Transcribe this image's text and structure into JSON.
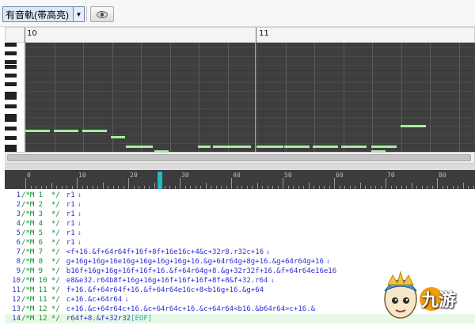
{
  "toolbar": {
    "track_select_value": "有音軌(帯高亮)",
    "dropdown_icon": "chevron-down-icon",
    "visibility_icon": "eye-icon"
  },
  "piano_roll": {
    "measures": [
      "10",
      "11"
    ]
  },
  "editor_ruler": {
    "ticks": [
      "0",
      "10",
      "20",
      "30",
      "40",
      "50",
      "60",
      "70",
      "80"
    ]
  },
  "editor": {
    "lines": [
      {
        "num": "1",
        "comment": "/*M 1  */",
        "code": "r1",
        "eol": "↓",
        "eof": ""
      },
      {
        "num": "2",
        "comment": "/*M 2  */",
        "code": "r1",
        "eol": "↓",
        "eof": ""
      },
      {
        "num": "3",
        "comment": "/*M 3  */",
        "code": "r1",
        "eol": "↓",
        "eof": ""
      },
      {
        "num": "4",
        "comment": "/*M 4  */",
        "code": "r1",
        "eol": "↓",
        "eof": ""
      },
      {
        "num": "5",
        "comment": "/*M 5  */",
        "code": "r1",
        "eol": "↓",
        "eof": ""
      },
      {
        "num": "6",
        "comment": "/*M 6  */",
        "code": "r1",
        "eol": "↓",
        "eof": ""
      },
      {
        "num": "7",
        "comment": "/*M 7  */",
        "code": "<f+16.&f+64r64f+16f+8f+16e16c+4&c+32r8.r32c+16",
        "eol": "↓",
        "eof": ""
      },
      {
        "num": "8",
        "comment": "/*M 8  */",
        "code": "g+16g+16g+16e16g+16g+16g+16g+16.&g+64r64g+8g+16.&g+64r64g+16",
        "eol": "↓",
        "eof": ""
      },
      {
        "num": "9",
        "comment": "/*M 9  */",
        "code": "b16f+16g+16g+16f+16f+16.&f+64r64g+8.&g+32r32f+16.&f+64r64e16e16",
        "eol": "",
        "eof": ""
      },
      {
        "num": "10",
        "comment": "/*M 10 */",
        "code": "e8&e32.r64b8f+16g+16g+16f+16f+16f+8f+8&f+32.r64",
        "eol": "↓",
        "eof": ""
      },
      {
        "num": "11",
        "comment": "/*M 11 */",
        "code": "f+16.&f+64r64f+16.&f+64r64e16c+8<b16g+16.&g+64",
        "eol": "",
        "eof": ""
      },
      {
        "num": "12",
        "comment": "/*M 11 */",
        "code": "c+16.&c+64r64",
        "eol": "↓",
        "eof": ""
      },
      {
        "num": "13",
        "comment": "/*M 12 */",
        "code": "c+16.&c+64r64c+16.&c+64r64c+16.&c+64r64<b16.&b64r64>c+16.&",
        "eol": "",
        "eof": ""
      },
      {
        "num": "14",
        "comment": "/*M 12 */",
        "code": "r64f+8.&f+32r32",
        "eol": "",
        "eof": "[EOF]"
      }
    ]
  },
  "watermark": {
    "brand_text": "九游",
    "mascot_icon": "mascot-logo-icon"
  }
}
